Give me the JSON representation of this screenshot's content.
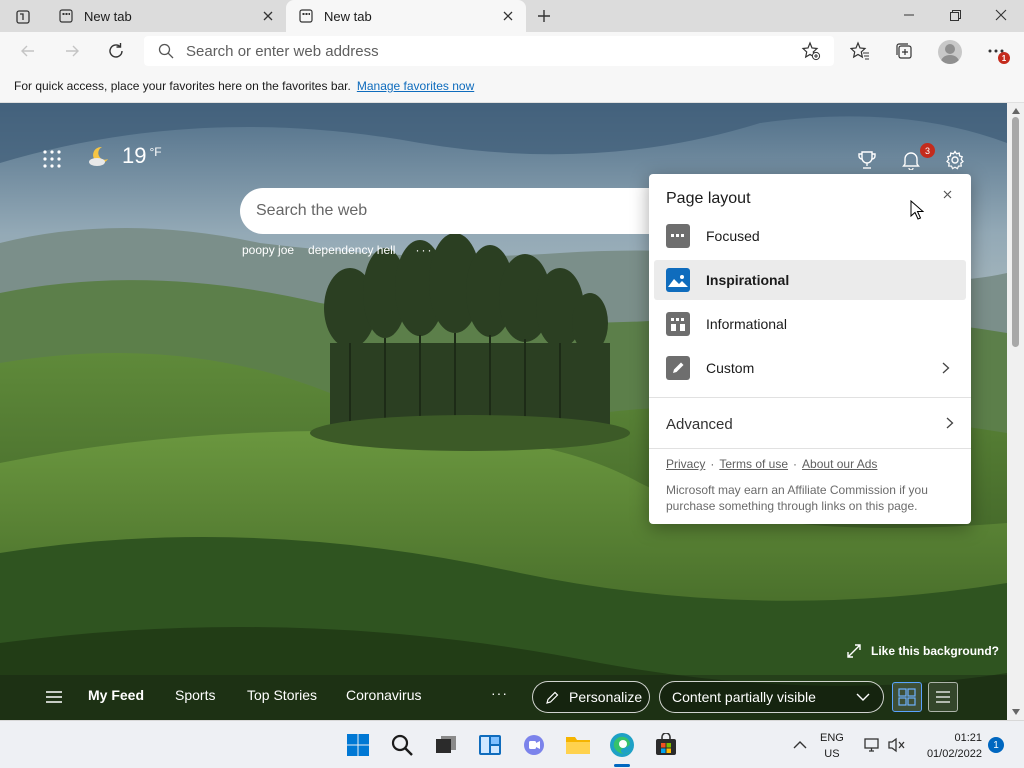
{
  "tabs": [
    {
      "title": "New tab",
      "active": false
    },
    {
      "title": "New tab",
      "active": true
    }
  ],
  "address": {
    "placeholder": "Search or enter web address"
  },
  "favorites_bar": {
    "message": "For quick access, place your favorites here on the favorites bar.",
    "link": "Manage favorites now"
  },
  "toolbar": {
    "more_badge": "1"
  },
  "weather": {
    "temp": "19",
    "unit": "°F"
  },
  "ntp": {
    "notifications_count": "3",
    "search_placeholder": "Search the web",
    "quick_links": [
      "poopy joe",
      "dependency hell"
    ],
    "more_links": "···"
  },
  "flyout": {
    "title": "Page layout",
    "options": [
      {
        "label": "Focused",
        "selected": false
      },
      {
        "label": "Inspirational",
        "selected": true
      },
      {
        "label": "Informational",
        "selected": false
      },
      {
        "label": "Custom",
        "selected": false
      }
    ],
    "advanced": "Advanced",
    "links": [
      "Privacy",
      "Terms of use",
      "About our Ads"
    ],
    "bullet": "·",
    "disclaimer": "Microsoft may earn an Affiliate Commission if you purchase something through links on this page."
  },
  "background": {
    "like_text": "Like this background?"
  },
  "feed": {
    "tabs": [
      "My Feed",
      "Sports",
      "Top Stories",
      "Coronavirus"
    ],
    "more": "···",
    "personalize": "Personalize",
    "content_visibility": "Content partially visible"
  },
  "taskbar": {
    "lang_line1": "ENG",
    "lang_line2": "US",
    "time": "01:21",
    "date": "01/02/2022",
    "notifications": "1"
  },
  "colors": {
    "accent": "#0067c0",
    "badge": "#c42b1c",
    "link": "#0f6cbd"
  }
}
